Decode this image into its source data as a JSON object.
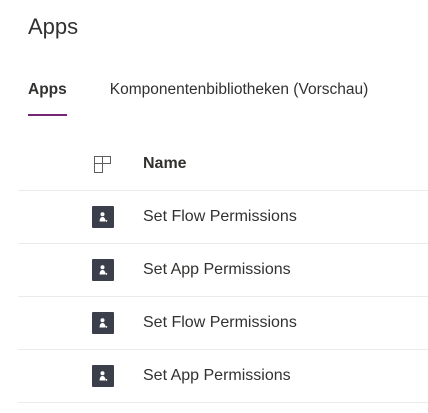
{
  "page": {
    "title": "Apps"
  },
  "tabs": [
    {
      "label": "Apps",
      "active": true
    },
    {
      "label": "Komponentenbibliotheken (Vorschau)",
      "active": false
    }
  ],
  "table": {
    "header": {
      "type_icon": "file-type-icon",
      "name_label": "Name"
    },
    "rows": [
      {
        "icon": "canvas-app-icon",
        "name": "Set Flow Permissions"
      },
      {
        "icon": "canvas-app-icon",
        "name": "Set App Permissions"
      },
      {
        "icon": "canvas-app-icon",
        "name": "Set Flow Permissions"
      },
      {
        "icon": "canvas-app-icon",
        "name": "Set App Permissions"
      }
    ]
  },
  "colors": {
    "accent": "#742774",
    "text": "#323130",
    "divider": "#edebe9",
    "app_icon_bg": "#3b3f4b"
  }
}
